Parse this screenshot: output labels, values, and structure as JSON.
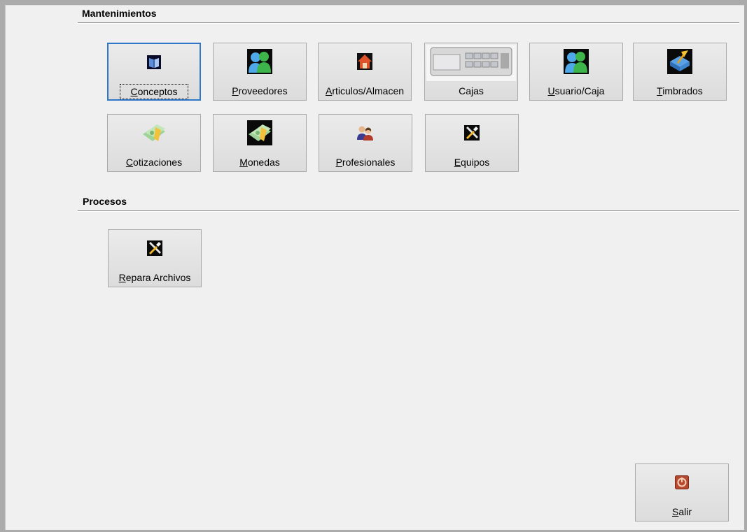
{
  "sections": {
    "mantenimientos": "Mantenimientos",
    "procesos": "Procesos"
  },
  "mantenimientos": [
    {
      "key": "C",
      "rest": "onceptos",
      "icon": "book-icon"
    },
    {
      "key": "P",
      "rest": "roveedores",
      "icon": "users-icon"
    },
    {
      "key": "A",
      "rest": "rticulos/Almacen",
      "icon": "house-icon"
    },
    {
      "pre": "Ca",
      "key": "j",
      "rest": "as",
      "icon": "cash-register-icon"
    },
    {
      "key": "U",
      "rest": "suario/Caja",
      "icon": "users-icon"
    },
    {
      "key": "T",
      "rest": "imbrados",
      "icon": "stamp-icon"
    },
    {
      "key": "C",
      "rest": "otizaciones",
      "icon": "money-icon"
    },
    {
      "key": "M",
      "rest": "onedas",
      "icon": "money-icon"
    },
    {
      "key": "P",
      "rest": "rofesionales",
      "icon": "professionals-icon"
    },
    {
      "key": "E",
      "rest": "quipos",
      "icon": "tools-icon"
    }
  ],
  "procesos": [
    {
      "key": "R",
      "rest": "epara Archivos",
      "icon": "tools-icon"
    }
  ],
  "salir": {
    "key": "S",
    "rest": "alir",
    "icon": "power-icon"
  },
  "colors": {
    "focus": "#2f77c8",
    "background": "#f0f0f0"
  }
}
